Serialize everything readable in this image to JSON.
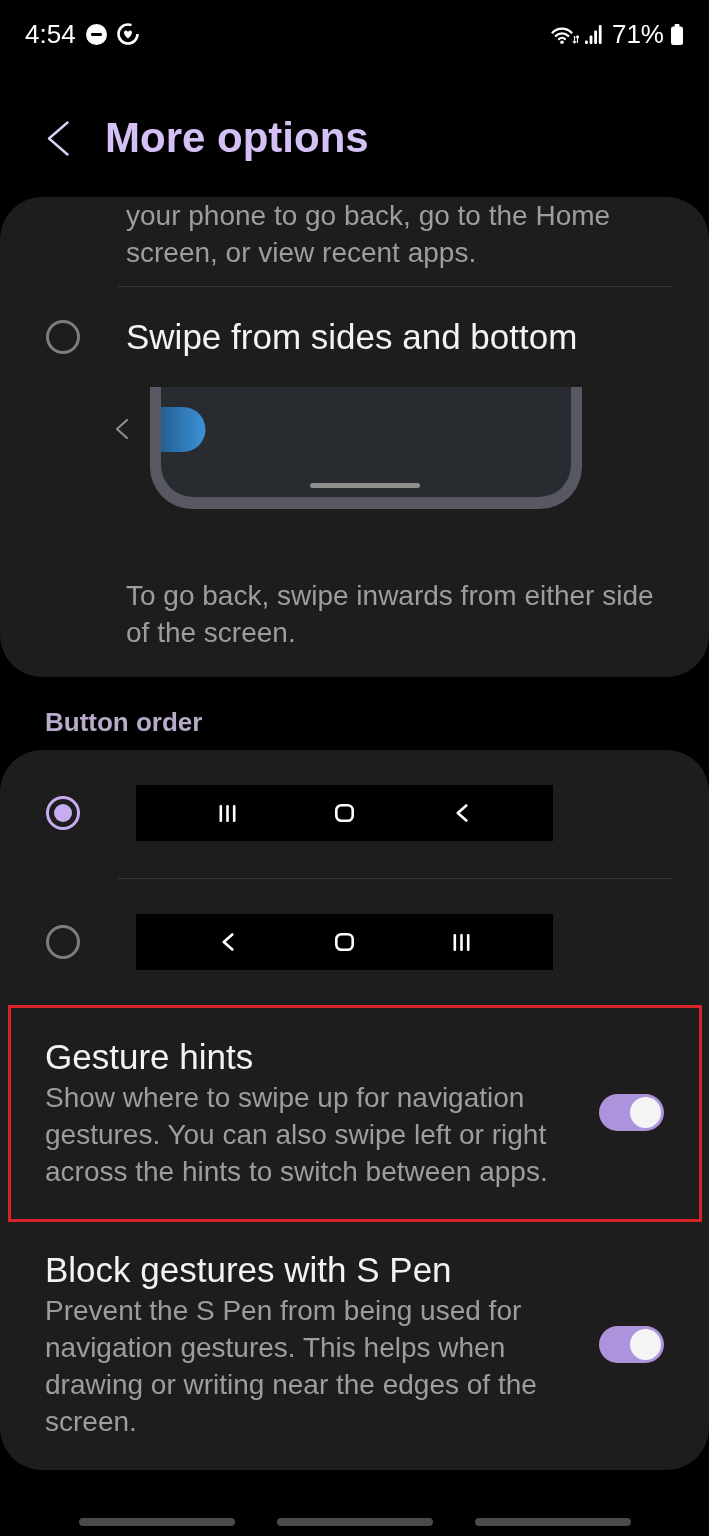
{
  "status_bar": {
    "time": "4:54",
    "battery": "71%"
  },
  "header": {
    "title": "More options"
  },
  "navigation_type": {
    "previous_description": "your phone to go back, go to the Home screen, or view recent apps.",
    "options": [
      {
        "label": "Swipe from sides and bottom",
        "selected": false,
        "description": "To go back, swipe inwards from either side of the screen."
      }
    ]
  },
  "button_order": {
    "heading": "Button order",
    "options": [
      {
        "selected": true,
        "buttons": [
          {
            "kind": "recents"
          },
          {
            "kind": "home"
          },
          {
            "kind": "back"
          }
        ]
      },
      {
        "selected": false,
        "buttons": [
          {
            "kind": "back"
          },
          {
            "kind": "home"
          },
          {
            "kind": "recents"
          }
        ]
      }
    ]
  },
  "toggles": [
    {
      "title": "Gesture hints",
      "description": "Show where to swipe up for navigation gestures. You can also swipe left or right across the hints to switch between apps.",
      "on": true,
      "highlighted": true
    },
    {
      "title": "Block gestures with S Pen",
      "description": "Prevent the S Pen from being used for navigation gestures. This helps when drawing or writing near the edges of the screen.",
      "on": true,
      "highlighted": false
    }
  ]
}
